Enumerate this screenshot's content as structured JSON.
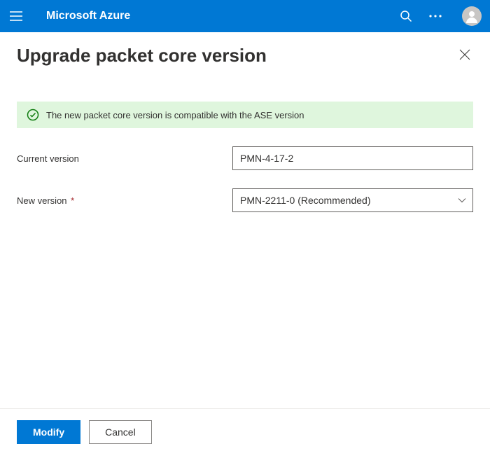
{
  "header": {
    "brand": "Microsoft Azure"
  },
  "page": {
    "title": "Upgrade packet core version"
  },
  "banner": {
    "message": "The new packet core version is compatible with the ASE version",
    "status_color": "#107c10"
  },
  "form": {
    "current_version_label": "Current version",
    "current_version_value": "PMN-4-17-2",
    "new_version_label": "New version",
    "new_version_value": "PMN-2211-0 (Recommended)"
  },
  "footer": {
    "primary_label": "Modify",
    "secondary_label": "Cancel"
  }
}
